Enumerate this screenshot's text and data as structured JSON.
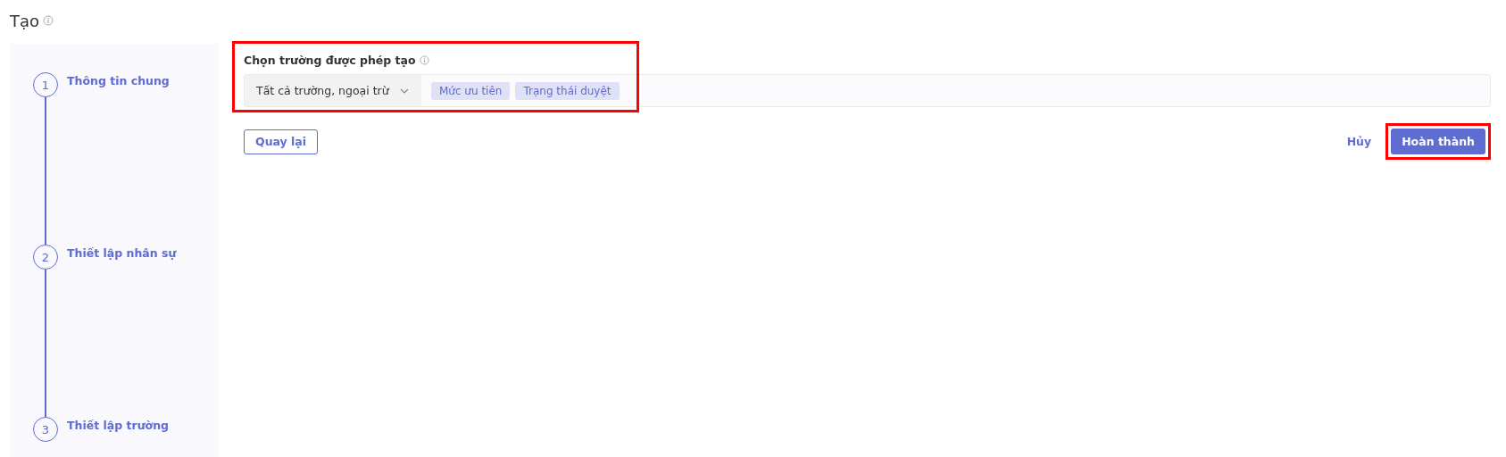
{
  "title": "Tạo",
  "steps": [
    {
      "number": "1",
      "label": "Thông tin chung"
    },
    {
      "number": "2",
      "label": "Thiết lập nhân sự"
    },
    {
      "number": "3",
      "label": "Thiết lập trường"
    }
  ],
  "field": {
    "label": "Chọn trường được phép tạo",
    "highlighted": true,
    "mode": "Tất cả trường, ngoại trừ",
    "tags": [
      "Mức ưu tiên",
      "Trạng thái duyệt"
    ]
  },
  "buttons": {
    "back": {
      "label": "Quay lại"
    },
    "cancel": {
      "label": "Hủy"
    },
    "finish": {
      "label": "Hoàn thành",
      "highlighted": true
    }
  }
}
